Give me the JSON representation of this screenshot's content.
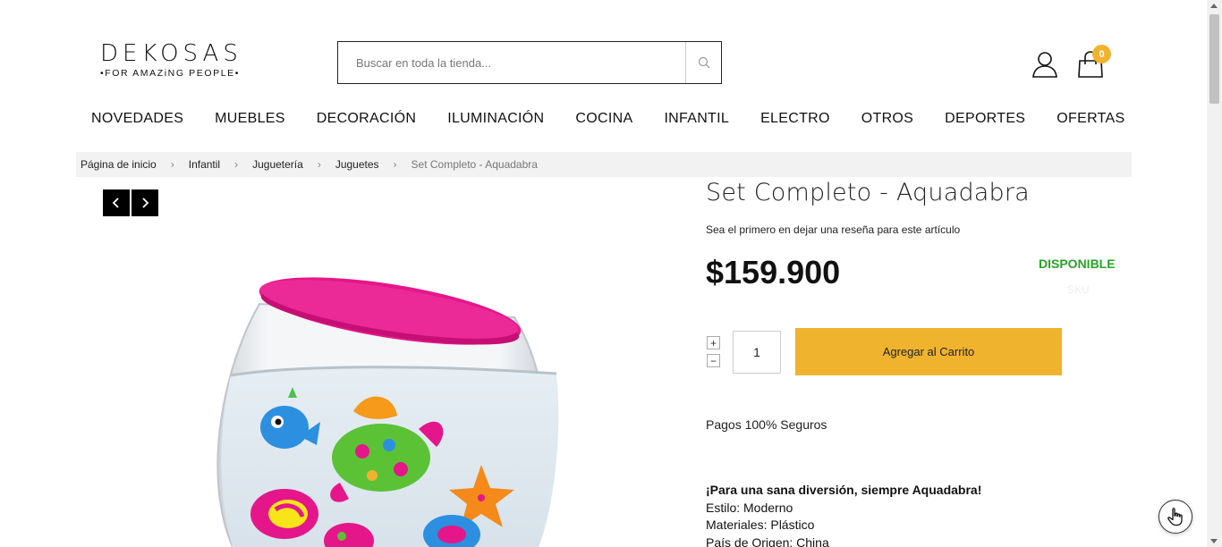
{
  "header": {
    "logo_main": "DEKOSAS",
    "logo_sub": "•FOR AMAZiNG PEOPLE•",
    "search_placeholder": "Buscar en toda la tienda...",
    "cart_count": "0"
  },
  "nav": {
    "items": [
      "NOVEDADES",
      "MUEBLES",
      "DECORACIÓN",
      "ILUMINACIÓN",
      "COCINA",
      "INFANTIL",
      "ELECTRO",
      "OTROS",
      "DEPORTES",
      "OFERTAS"
    ]
  },
  "breadcrumb": {
    "items": [
      "Página de inicio",
      "Infantil",
      "Juguetería",
      "Juguetes",
      "Set Completo - Aquadabra"
    ],
    "separator": "›"
  },
  "product": {
    "title": "Set Completo - Aquadabra",
    "review_prompt": "Sea el primero en dejar una reseña para este artículo",
    "price": "$159.900",
    "stock": "DISPONIBLE",
    "sku_label": "SKU",
    "qty_plus": "+",
    "qty_minus": "−",
    "qty": "1",
    "add_to_cart": "Agregar al Carrito",
    "secure": "Pagos 100% Seguros",
    "tagline": "¡Para una sana diversión, siempre Aquadabra!",
    "details": [
      "Estilo: Moderno",
      "Materiales: Plástico",
      "País de Origen: China"
    ]
  },
  "colors": {
    "accent": "#f0b32e",
    "stock": "#2aa22a",
    "lid": "#e5168a"
  }
}
